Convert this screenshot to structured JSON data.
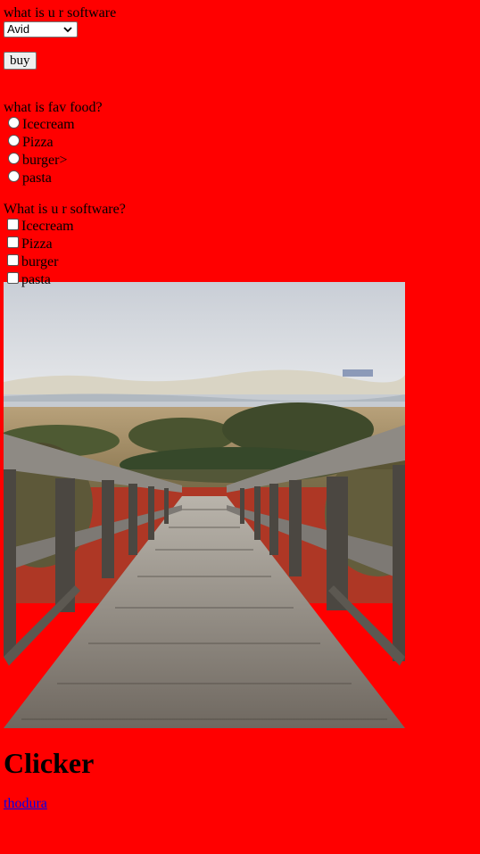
{
  "software_form": {
    "label": "what is u r software",
    "selected": "Avid",
    "buy_label": "buy"
  },
  "food_question": {
    "label": "what is fav food?",
    "options": [
      "Icecream",
      "Pizza",
      "burger>",
      "pasta"
    ]
  },
  "software_question": {
    "label": "What is u r software?",
    "options": [
      "Icecream",
      "Pizza",
      "burger",
      "pasta"
    ]
  },
  "photo": {
    "alt": "wooden boardwalk leading through dunes"
  },
  "heading": "Clicker",
  "link_text": "thodura",
  "colors": {
    "page_background": "#ff0000",
    "link": "#0000ee"
  }
}
